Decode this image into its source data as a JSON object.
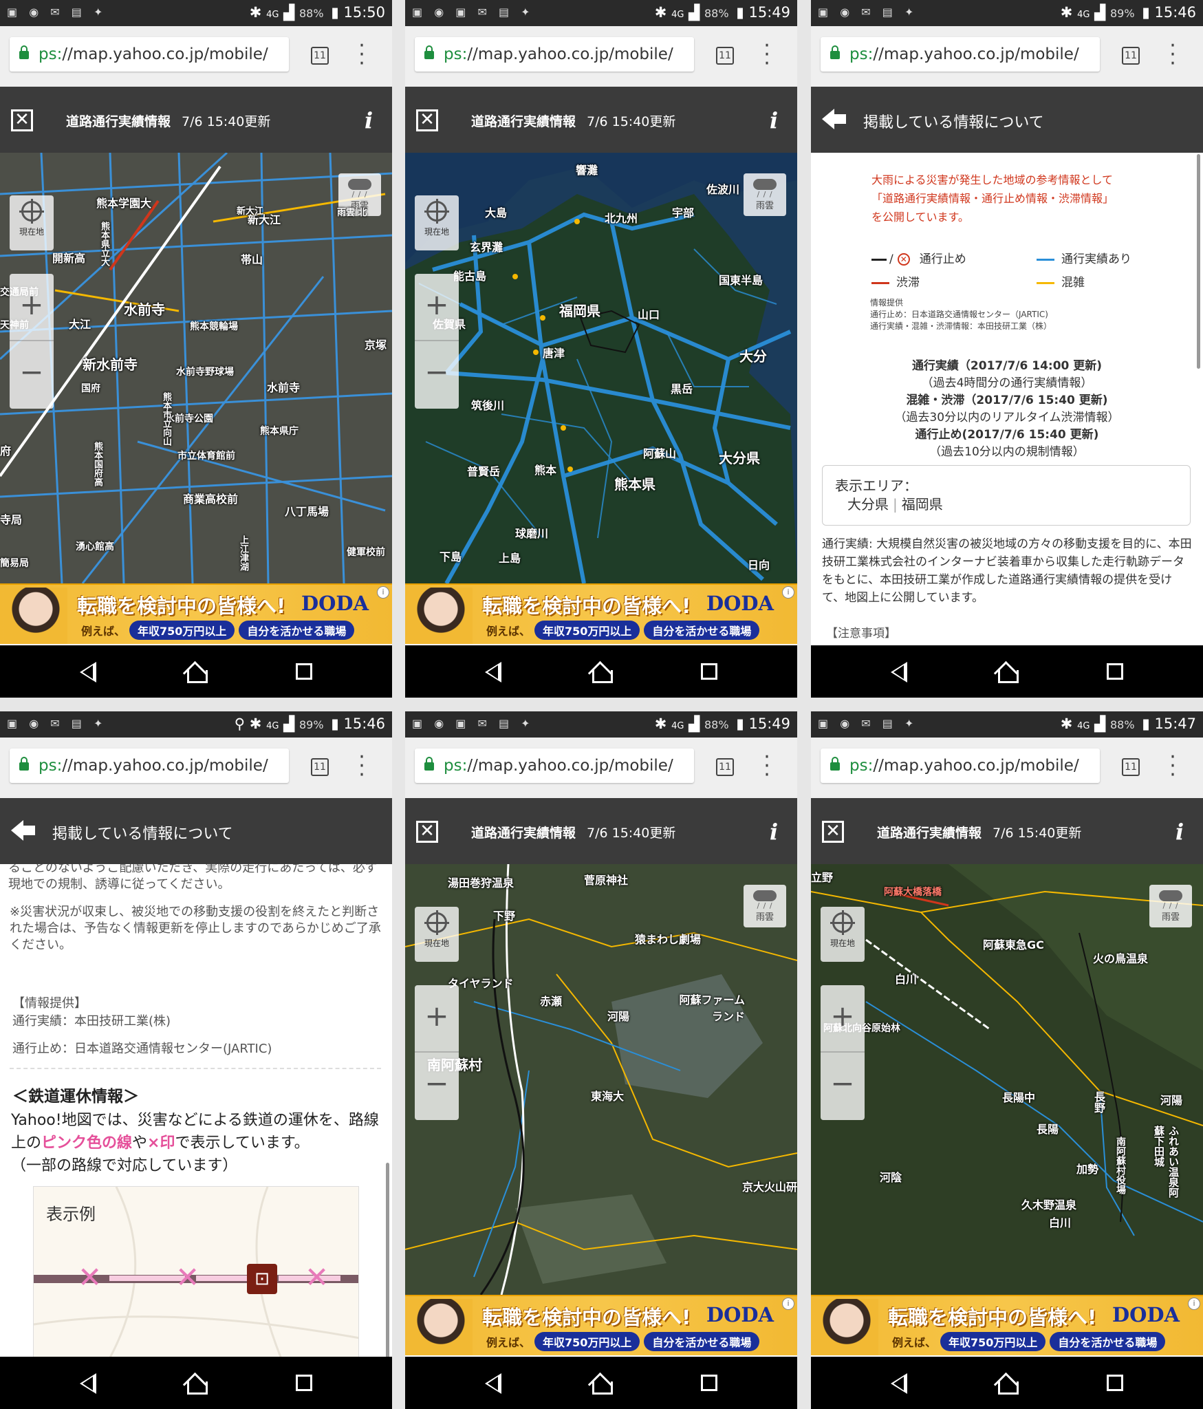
{
  "status_bars": [
    {
      "time": "15:50",
      "battery": "88%",
      "network": "4G"
    },
    {
      "time": "15:49",
      "battery": "88%",
      "network": "4G"
    },
    {
      "time": "15:46",
      "battery": "89%",
      "network": "4G"
    },
    {
      "time": "15:46",
      "battery": "89%",
      "network": "4G"
    },
    {
      "time": "15:49",
      "battery": "88%",
      "network": "4G"
    },
    {
      "time": "15:47",
      "battery": "88%",
      "network": "4G"
    }
  ],
  "browser": {
    "url_scheme": "ps:",
    "url_rest": "//map.yahoo.co.jp/mobile/",
    "tab_count": "11"
  },
  "map_header": {
    "title": "道路通行実績情報",
    "updated": "7/6 15:40更新"
  },
  "info_header": {
    "title": "掲載している情報について"
  },
  "map_controls": {
    "current_location": "現在地",
    "zoom_in": "+",
    "zoom_out": "−",
    "rain_cloud": "雨雲"
  },
  "ad": {
    "headline": "転職を検討中の皆様へ!",
    "brand": "DODA",
    "sub_prefix": "例えば、",
    "pill1": "年収750万円以上",
    "pill2": "自分を活かせる職場"
  },
  "map1_labels": [
    "熊本学園大",
    "新大江",
    "帯山",
    "開新高",
    "交通局前",
    "大江",
    "水前寺",
    "熊本競輪場",
    "京塚",
    "新水前寺",
    "水前寺野球場",
    "国府",
    "水前寺",
    "水前寺公園",
    "熊本県庁",
    "市立体育館前",
    "商業高校前",
    "八丁馬場",
    "湧心館高",
    "健軍校前",
    "簡易局",
    "熊本国府高",
    "熊本県立大",
    "熊本市立向山",
    "上江津湖",
    "府",
    "寺局",
    "新大江",
    "天神前",
    "雨雲 北"
  ],
  "map2_labels": [
    "響灘",
    "佐波川",
    "大島",
    "宇部",
    "北九州",
    "玄界灘",
    "能古島",
    "国東半島",
    "福岡県",
    "山口",
    "佐賀県",
    "唐津",
    "大分",
    "黒岳",
    "大分県",
    "筑後川",
    "阿蘇山",
    "熊本県",
    "熊本",
    "普賢岳",
    "球磨川",
    "日向",
    "下島",
    "上島"
  ],
  "map5_labels": [
    "湯田巻狩温泉",
    "菅原神社",
    "下野",
    "猿まわし劇場",
    "タイヤランド",
    "赤瀬",
    "河陽",
    "阿蘇ファームランド",
    "南阿蘇村",
    "東海大",
    "京大火山研"
  ],
  "map6_labels": [
    "立野",
    "阿蘇大橋落橋",
    "阿蘇東急GC",
    "火の鳥温泉",
    "白川",
    "長陽中",
    "長陽",
    "阿蘇北向谷原始林",
    "長野",
    "河陽",
    "加勢",
    "南阿蘇村役場",
    "ふれあい温泉阿蘇下田城",
    "河陰",
    "久木野温泉",
    "白川"
  ],
  "info_page": {
    "intro": [
      "大雨による災害が発生した地域の参考情報として",
      "「道路通行実績情報・通行止め情報・渋滞情報」",
      "を公開しています。"
    ],
    "legend": {
      "stop": "通行止め",
      "jam": "渋滞",
      "passable": "通行実績あり",
      "congested": "混雑",
      "stop_prefix": "/"
    },
    "provider": [
      "情報提供",
      "通行止め：日本道路交通情報センター（JARTIC)",
      "通行実績・混雑・渋滞情報：本田技研工業（株）"
    ],
    "updates": [
      {
        "label": "通行実績（2017/7/6 14:00 更新)",
        "note": "（過去4時間分の通行実績情報）"
      },
      {
        "label": "混雑・渋滞（2017/7/6 15:40 更新)",
        "note": "（過去30分以内のリアルタイム渋滞情報）"
      },
      {
        "label": "通行止め(2017/7/6 15:40 更新)",
        "note": "（過去10分以内の規制情報）"
      }
    ],
    "area_label": "表示エリア：",
    "area_values": [
      "大分県",
      "福岡県"
    ],
    "body": "通行実績: 大規模自然災害の被災地域の方々の移動支援を目的に、本田技研工業株式会社のインターナビ装着車から収集した走行軌跡データをもとに、本田技研工業が作成した道路通行実績情報の提供を受けて、地図上に公開しています。",
    "caution": "【注意事項】"
  },
  "info_page2": {
    "top_text": "ることのないようご配慮いただき、実際の走行にあたっては、必ず現地での規制、誘導に従ってください。",
    "note": "※災害状況が収束し、被災地での移動支援の役割を終えたと判断された場合は、予告なく情報更新を停止しますのであらかじめご了承ください。",
    "provider_heading": "【情報提供】",
    "provider1": "通行実績：本田技研工業(株)",
    "provider2": "通行止め：日本道路交通情報センター(JARTIC)",
    "rail_title": "＜鉄道運休情報＞",
    "rail_text_1": "Yahoo!地図では、災害などによる鉄道の運休を、路線上の",
    "rail_pink": "ピンク色の線",
    "rail_text_2": "や",
    "rail_x": "×印",
    "rail_text_3": "で表示しています。",
    "rail_text_4": "（一部の路線で対応しています）",
    "example_label": "表示例"
  },
  "colors": {
    "passable": "#2a8fd8",
    "congested": "#f5b800",
    "jam": "#d0361c",
    "appbar": "#3b3b3b",
    "rail_pink": "#e5509a"
  }
}
